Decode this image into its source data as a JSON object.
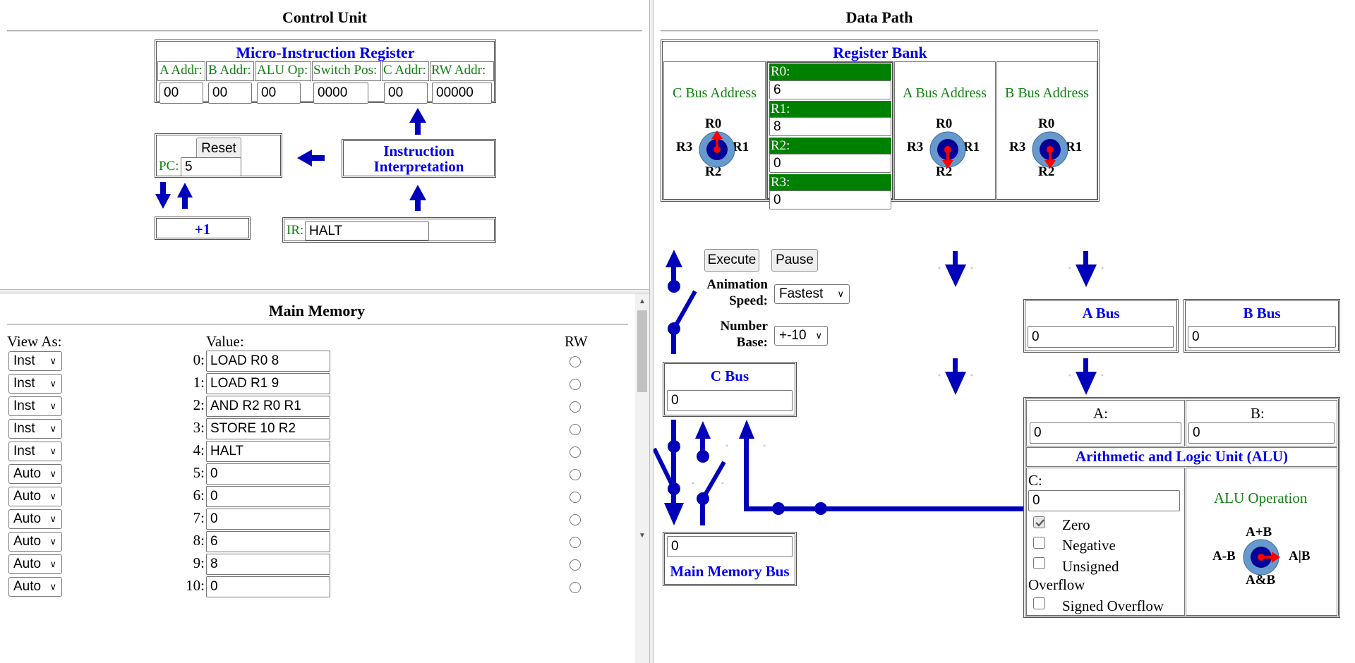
{
  "control_unit": {
    "title": "Control Unit",
    "mir": {
      "title": "Micro-Instruction Register",
      "fields": [
        {
          "label": "A Addr:",
          "value": "00"
        },
        {
          "label": "B Addr:",
          "value": "00"
        },
        {
          "label": "ALU Op:",
          "value": "00"
        },
        {
          "label": "Switch Pos:",
          "value": "0000"
        },
        {
          "label": "C Addr:",
          "value": "00"
        },
        {
          "label": "RW Addr:",
          "value": "00000"
        }
      ]
    },
    "pc": {
      "reset_label": "Reset",
      "label": "PC:",
      "value": "5"
    },
    "instruction_interpretation": "Instruction Interpretation",
    "plus_one": "+1",
    "ir": {
      "label": "IR:",
      "value": "HALT"
    }
  },
  "main_memory": {
    "title": "Main Memory",
    "view_as_header": "View As:",
    "value_header": "Value:",
    "rw_header": "RW",
    "rows": [
      {
        "view": "Inst",
        "addr": "0:",
        "value": "LOAD R0 8"
      },
      {
        "view": "Inst",
        "addr": "1:",
        "value": "LOAD R1 9"
      },
      {
        "view": "Inst",
        "addr": "2:",
        "value": "AND R2 R0 R1"
      },
      {
        "view": "Inst",
        "addr": "3:",
        "value": "STORE 10 R2"
      },
      {
        "view": "Inst",
        "addr": "4:",
        "value": "HALT"
      },
      {
        "view": "Auto",
        "addr": "5:",
        "value": "0"
      },
      {
        "view": "Auto",
        "addr": "6:",
        "value": "0"
      },
      {
        "view": "Auto",
        "addr": "7:",
        "value": "0"
      },
      {
        "view": "Auto",
        "addr": "8:",
        "value": "6"
      },
      {
        "view": "Auto",
        "addr": "9:",
        "value": "8"
      },
      {
        "view": "Auto",
        "addr": "10:",
        "value": "0"
      }
    ]
  },
  "data_path": {
    "title": "Data Path",
    "register_bank": {
      "title": "Register Bank",
      "c_bus_address": "C Bus Address",
      "a_bus_address": "A Bus Address",
      "b_bus_address": "B Bus Address",
      "dial_labels": {
        "top": "R0",
        "right": "R1",
        "bottom": "R2",
        "left": "R3"
      },
      "registers": [
        {
          "label": "R0:",
          "value": "6"
        },
        {
          "label": "R1:",
          "value": "8"
        },
        {
          "label": "R2:",
          "value": "0"
        },
        {
          "label": "R3:",
          "value": "0"
        }
      ]
    },
    "controls": {
      "execute": "Execute",
      "pause": "Pause",
      "animation_speed_label": "Animation Speed:",
      "animation_speed_value": "Fastest",
      "number_base_label": "Number Base:",
      "number_base_value": "+-10"
    },
    "a_bus": {
      "title": "A Bus",
      "value": "0"
    },
    "b_bus": {
      "title": "B Bus",
      "value": "0"
    },
    "c_bus": {
      "title": "C Bus",
      "value": "0"
    },
    "main_memory_bus": {
      "title": "Main Memory Bus",
      "value": "0"
    },
    "alu": {
      "title": "Arithmetic and Logic Unit (ALU)",
      "a_label": "A:",
      "a_value": "0",
      "b_label": "B:",
      "b_value": "0",
      "c_label": "C:",
      "c_value": "0",
      "flags": [
        {
          "label": "Zero",
          "checked": true
        },
        {
          "label": "Negative",
          "checked": false
        },
        {
          "label": "Unsigned Overflow",
          "checked": false
        },
        {
          "label": "Signed Overflow",
          "checked": false
        }
      ],
      "operation_label": "ALU Operation",
      "op_dial": {
        "top": "A+B",
        "right": "A|B",
        "bottom": "A&B",
        "left": "A-B"
      }
    }
  },
  "colors": {
    "arrow": "#0000bb",
    "dial_outer": "#6699cc",
    "dial_inner": "#000099",
    "pointer": "#ff0000",
    "register_header": "#008000"
  }
}
